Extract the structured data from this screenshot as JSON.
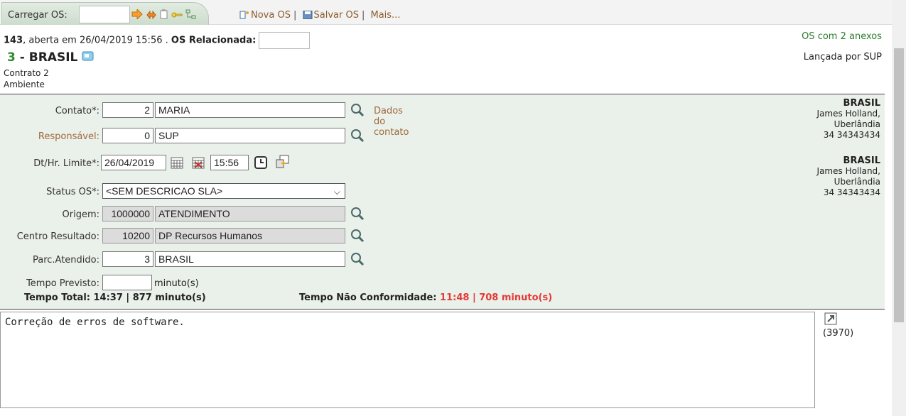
{
  "toolbar": {
    "carregar_label": "Carregar OS:",
    "carregar_value": "",
    "nova_os": "Nova OS",
    "salvar_os": "Salvar OS",
    "mais": "Mais...",
    "sep": "|"
  },
  "header": {
    "os_number": "143",
    "opened_text": ", aberta em 26/04/2019 15:56 . ",
    "relacionada_label": "OS Relacionada:",
    "relacionada_value": "",
    "anexos": "OS com 2 anexos",
    "title_num": "3",
    "title_sep": " - ",
    "title_name": "BRASIL",
    "lancada": "Lançada por SUP",
    "contrato": "Contrato 2",
    "ambiente": "Ambiente"
  },
  "form": {
    "contato": {
      "label": "Contato*:",
      "code": "2",
      "name": "MARIA",
      "link": "Dados do contato"
    },
    "responsavel": {
      "label": "Responsável:",
      "code": "0",
      "name": "SUP"
    },
    "limite": {
      "label": "Dt/Hr. Limite*:",
      "date": "26/04/2019",
      "time": "15:56"
    },
    "status": {
      "label": "Status OS*:",
      "value": "<SEM DESCRICAO SLA>"
    },
    "origem": {
      "label": "Origem:",
      "code": "1000000",
      "name": "ATENDIMENTO"
    },
    "centro": {
      "label": "Centro Resultado:",
      "code": "10200",
      "name": "DP Recursos Humanos"
    },
    "parc": {
      "label": "Parc.Atendido:",
      "code": "3",
      "name": "BRASIL"
    },
    "tempo_previsto": {
      "label": "Tempo Previsto:",
      "value": "",
      "unit": "minuto(s)"
    },
    "tempo_total_label": "Tempo Total: ",
    "tempo_total_value": "14:37 | 877 minuto(s)",
    "nao_conf_label": "Tempo Não Conformidade: ",
    "nao_conf_value": "11:48 | 708 minuto(s)"
  },
  "right_info": [
    {
      "name": "BRASIL",
      "line2": "James Holland,",
      "line3": "Uberlândia",
      "line4": "34 34343434"
    },
    {
      "name": "BRASIL",
      "line2": "James Holland,",
      "line3": "Uberlândia",
      "line4": "34 34343434"
    }
  ],
  "description": "Correção de erros de software.",
  "char_count": "(3970)"
}
